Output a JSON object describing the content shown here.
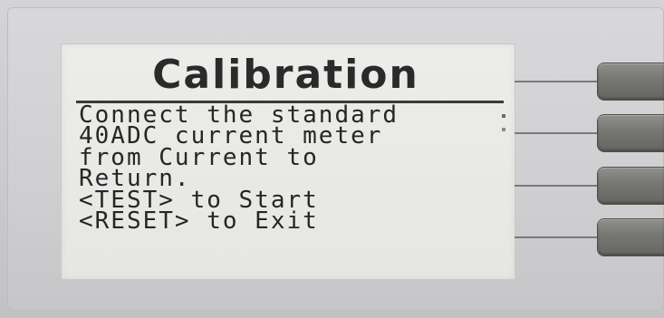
{
  "display": {
    "title": "Calibration",
    "lines": [
      "Connect the standard",
      "40ADC current meter",
      "from Current to",
      "Return.",
      "<TEST> to Start",
      "<RESET> to Exit"
    ]
  },
  "soft_keys": [
    {
      "label": ""
    },
    {
      "label": ""
    },
    {
      "label": ""
    },
    {
      "label": ""
    }
  ],
  "colors": {
    "bezel": "#cfcfd1",
    "lcd_background": "#e8e8e5",
    "lcd_text": "#262626",
    "key": "#767773"
  }
}
